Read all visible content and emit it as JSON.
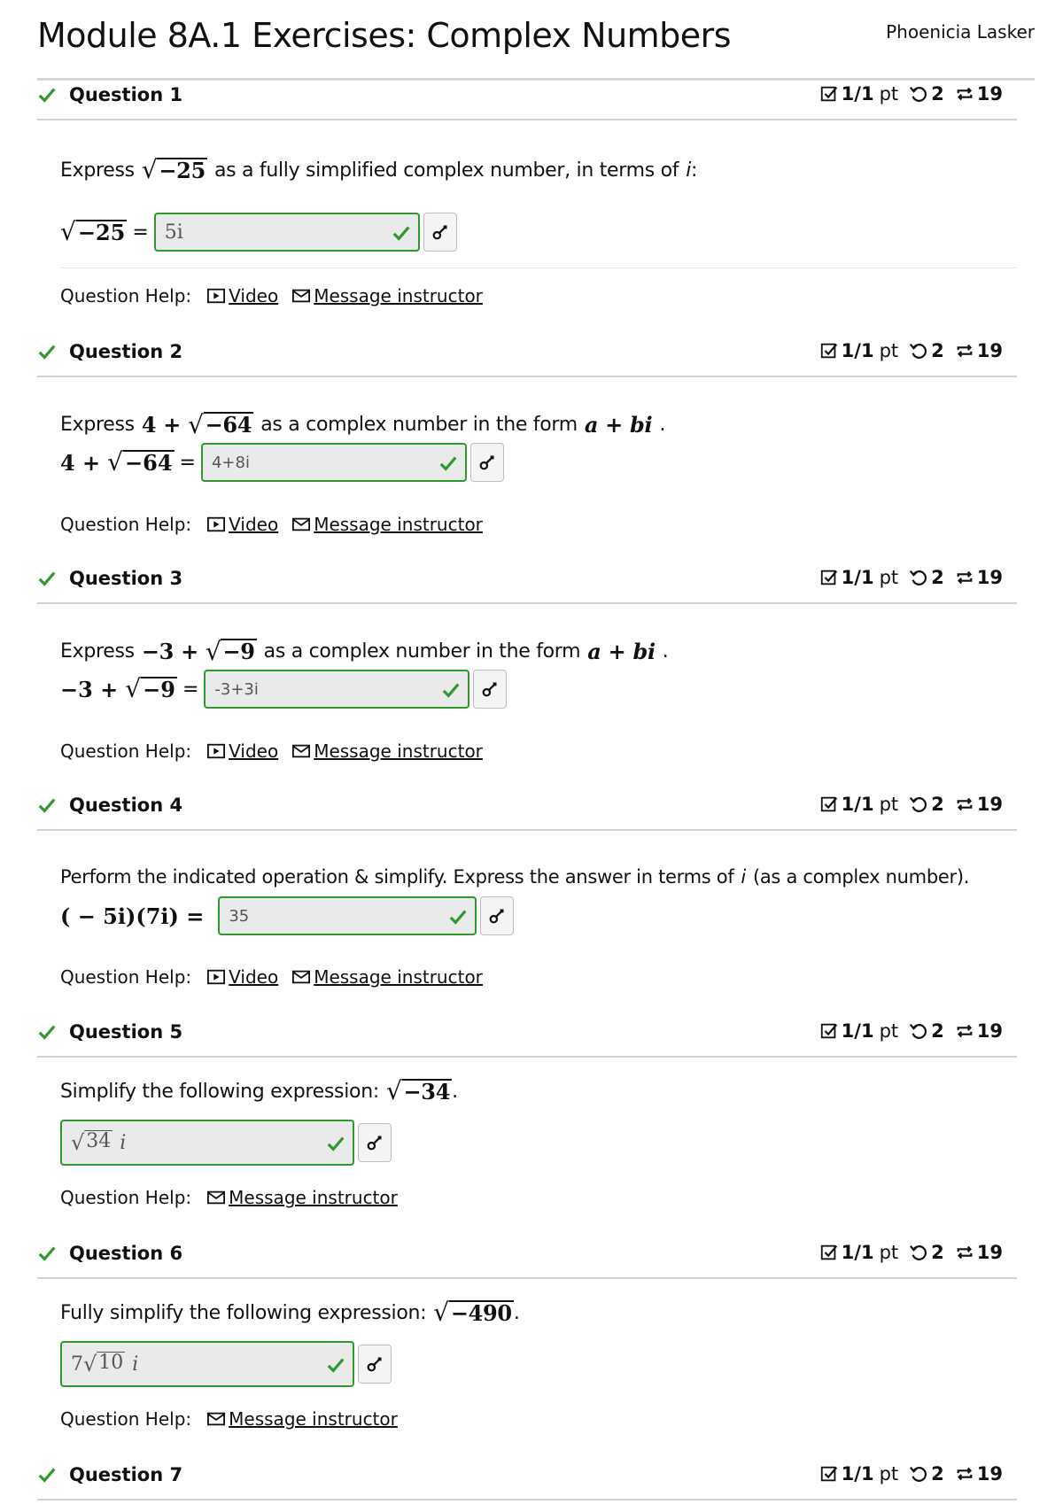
{
  "page": {
    "title": "Module 8A.1 Exercises: Complex Numbers",
    "user": "Phoenicia Lasker"
  },
  "meta": {
    "score": "1/1",
    "score_unit": "pt",
    "tries": "2",
    "attempts": "19"
  },
  "help": {
    "label": "Question Help:",
    "video": "Video",
    "message": "Message instructor"
  },
  "questions": [
    {
      "title": "Question 1",
      "prompt_before": "Express",
      "radicand": "−25",
      "prompt_after": "as a fully simplified complex number, in terms of",
      "prompt_var": "i",
      "prompt_end": ":",
      "answer": "5i"
    },
    {
      "title": "Question 2",
      "prompt_before": "Express",
      "lead": "4 +",
      "radicand": "−64",
      "prompt_after": "as a complex number in the form",
      "form": "a + bi",
      "prompt_end": ".",
      "answer": "4+8i"
    },
    {
      "title": "Question 3",
      "prompt_before": "Express",
      "lead": "−3 +",
      "radicand": "−9",
      "prompt_after": "as a complex number in the form",
      "form": "a + bi",
      "prompt_end": ".",
      "answer": "-3+3i"
    },
    {
      "title": "Question 4",
      "prompt_before": "Perform the indicated operation & simplify. Express the answer in terms of",
      "prompt_var": "i",
      "prompt_after": "(as a complex number).",
      "expression": "( − 5i)(7i) =",
      "answer": "35"
    },
    {
      "title": "Question 5",
      "prompt_before": "Simplify the following expression:",
      "radicand": "−34",
      "prompt_end": ".",
      "answer_radicand": "34",
      "answer_suffix": "i"
    },
    {
      "title": "Question 6",
      "prompt_before": "Fully simplify the following expression:",
      "radicand": "−490",
      "prompt_end": ".",
      "answer_coef": "7",
      "answer_radicand": "10",
      "answer_suffix": "i"
    },
    {
      "title": "Question 7"
    }
  ],
  "icons": {
    "check": "check-icon",
    "score": "checkbox-score-icon",
    "tries": "retry-icon",
    "attempts": "repeat-icon",
    "key": "key-icon",
    "video": "video-icon",
    "message": "mail-icon"
  },
  "colors": {
    "correct": "#2e9a2e",
    "divider": "#d3d3d3"
  }
}
